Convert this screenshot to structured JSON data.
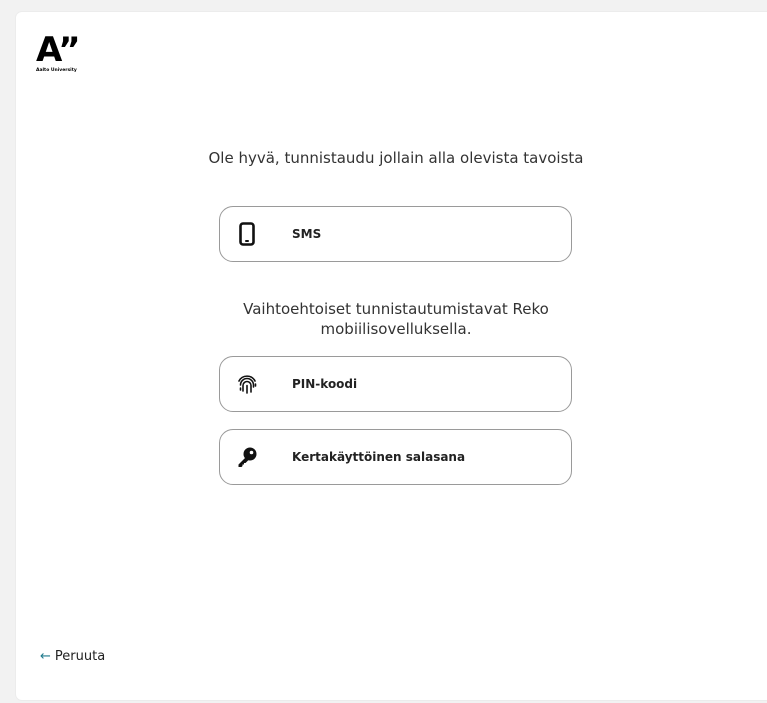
{
  "logo": {
    "mark": "A”",
    "subtitle": "Aalto University"
  },
  "prompt": {
    "primary": "Ole hyvä, tunnistaudu jollain alla olevista tavoista",
    "alternatives": "Vaihtoehtoiset tunnistautumistavat Reko mobiilisovelluksella."
  },
  "methods": [
    {
      "label": "SMS",
      "icon": "phone-icon"
    },
    {
      "label": "PIN-koodi",
      "icon": "fingerprint-icon"
    },
    {
      "label": "Kertakäyttöinen salasana",
      "icon": "key-icon"
    }
  ],
  "footer": {
    "cancel_label": "Peruuta",
    "cancel_icon": "arrow-left-icon",
    "accent_color": "#1f7a8c"
  }
}
